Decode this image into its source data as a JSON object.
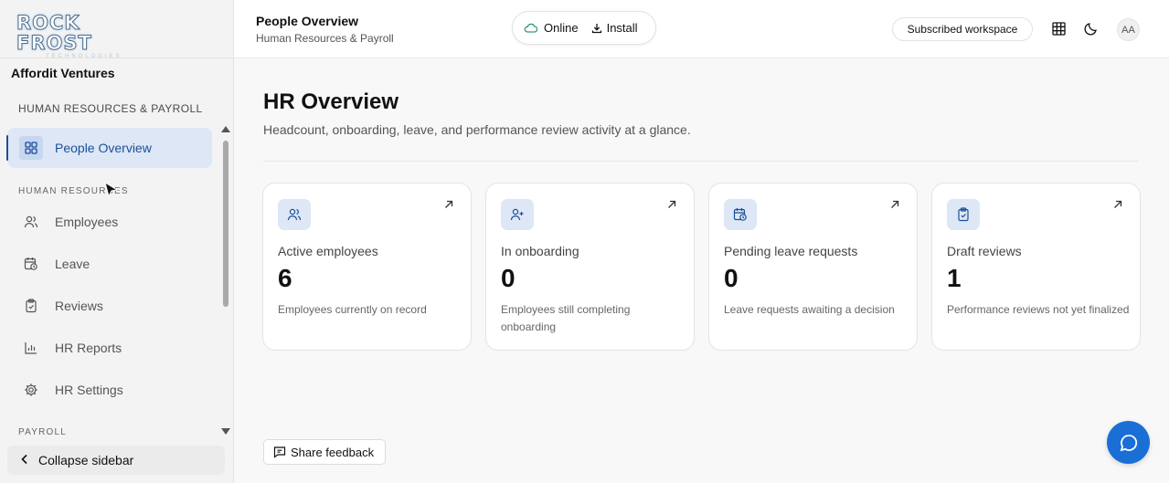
{
  "brand": {
    "logo_text": "ROCK FROST",
    "logo_sub": "TECHNOLOGIES"
  },
  "sidebar": {
    "org_name": "Affordit Ventures",
    "section_title": "HUMAN RESOURCES & PAYROLL",
    "items_top": [
      {
        "label": "People Overview",
        "icon": "grid-icon",
        "active": true
      }
    ],
    "subsection_hr": "HUMAN RESOURCES",
    "items": [
      {
        "label": "Employees",
        "icon": "users-icon"
      },
      {
        "label": "Leave",
        "icon": "calendar-clock-icon"
      },
      {
        "label": "Reviews",
        "icon": "clipboard-check-icon"
      },
      {
        "label": "HR Reports",
        "icon": "bar-chart-icon"
      },
      {
        "label": "HR Settings",
        "icon": "gear-icon"
      }
    ],
    "subsection_payroll": "PAYROLL",
    "collapse_label": "Collapse sidebar"
  },
  "header": {
    "title": "People Overview",
    "subtitle": "Human Resources & Payroll",
    "status_label": "Online",
    "install_label": "Install",
    "workspace_label": "Subscribed workspace",
    "avatar_initials": "AA"
  },
  "main": {
    "title": "HR Overview",
    "description": "Headcount, onboarding, leave, and performance review activity at a glance.",
    "cards": [
      {
        "label": "Active employees",
        "value": "6",
        "desc": "Employees currently on record",
        "icon": "users-icon"
      },
      {
        "label": "In onboarding",
        "value": "0",
        "desc": "Employees still completing onboarding",
        "icon": "user-plus-icon"
      },
      {
        "label": "Pending leave requests",
        "value": "0",
        "desc": "Leave requests awaiting a decision",
        "icon": "calendar-clock-icon"
      },
      {
        "label": "Draft reviews",
        "value": "1",
        "desc": "Performance reviews not yet finalized",
        "icon": "clipboard-check-icon"
      }
    ],
    "feedback_label": "Share feedback"
  },
  "colors": {
    "accent": "#1a4f9c",
    "accent_bg": "#dde7f5",
    "fab": "#1a6fd6",
    "online": "#2f9e6a"
  }
}
